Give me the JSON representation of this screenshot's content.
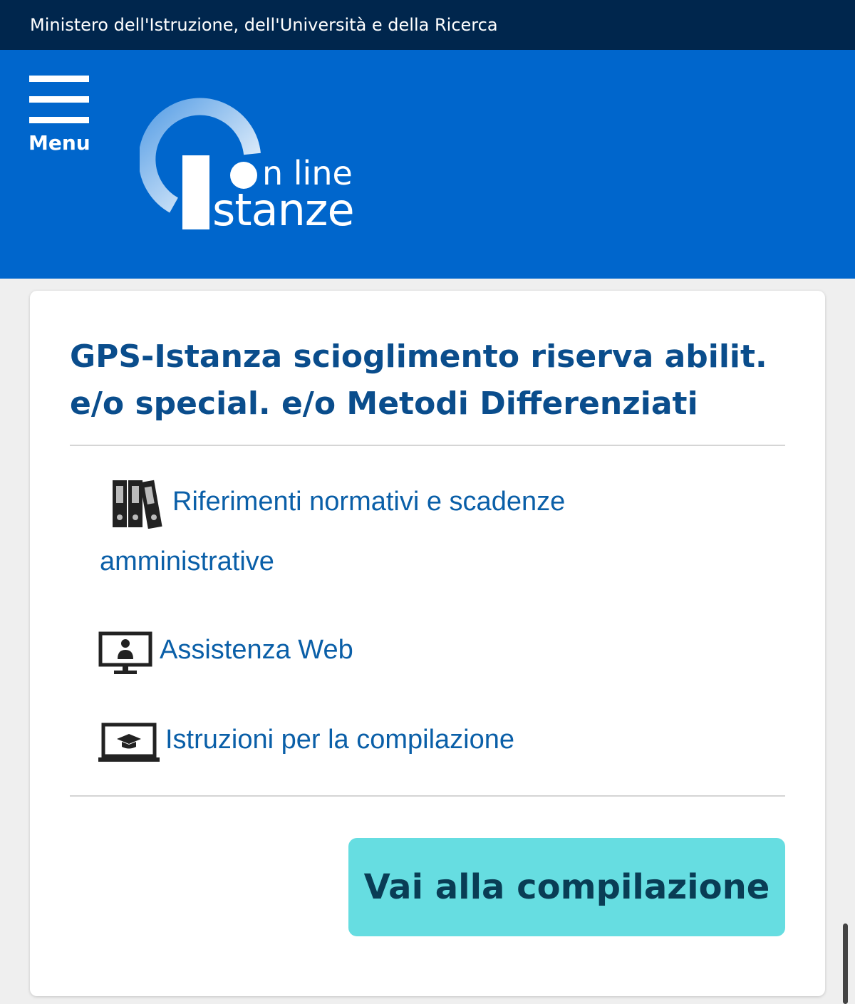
{
  "topbar": {
    "ministry": "Ministero dell'Istruzione, dell'Università e della Ricerca"
  },
  "header": {
    "menu_label": "Menu",
    "logo": {
      "line1": "n line",
      "line2": "stanze",
      "name": "Istanze On line"
    }
  },
  "card": {
    "title": "GPS-Istanza scioglimento riserva abilit. e/o special. e/o Metodi Differenziati",
    "links": [
      {
        "icon": "binders-icon",
        "label": "Riferimenti normativi e scadenze amministrative"
      },
      {
        "icon": "monitor-person-icon",
        "label": "Assistenza Web"
      },
      {
        "icon": "laptop-graduation-icon",
        "label": "Istruzioni per la compilazione"
      }
    ],
    "cta_label": "Vai alla compilazione"
  },
  "colors": {
    "topbar": "#00264d",
    "header": "#0066cc",
    "title": "#0a4d8c",
    "link": "#0a5fa8",
    "cta": "#66dde1",
    "cta_text": "#093d55"
  }
}
